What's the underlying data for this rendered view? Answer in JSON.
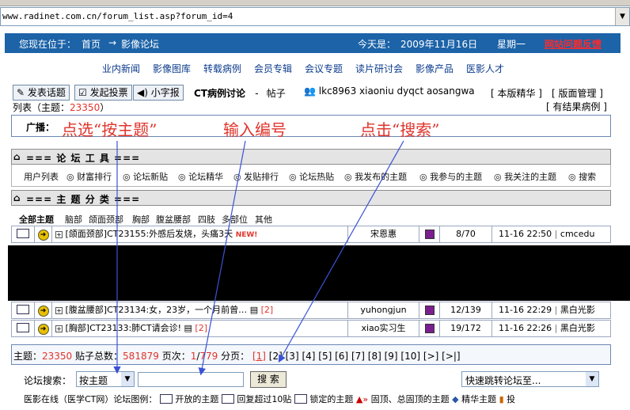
{
  "browser": {
    "url": "www.radinet.com.cn/forum_list.asp?forum_id=4"
  },
  "topbar": {
    "location_label": "您现在位于：",
    "home": "首页",
    "arrow": "→",
    "forum": "影像论坛",
    "today_label": "今天是：",
    "date": "2009年11月16日",
    "weekday": "星期一",
    "feedback": "网站问题反馈"
  },
  "nav": [
    "业内新闻",
    "影像图库",
    "转载病例",
    "会员专辑",
    "会议专题",
    "读片研讨会",
    "影像产品",
    "医影人才"
  ],
  "toolbar": {
    "post_topic": "发表话题",
    "post_vote": "发起投票",
    "small_font": "小字报",
    "board_name": "CT病例讨论",
    "dash": "-",
    "sub": "帖子",
    "list_label": "列表",
    "topic_count_prefix": "（主题：",
    "topic_count": "23350",
    "topic_count_suffix": "）",
    "moderators": "lkc8963 xiaoniu dyqct aosangwa",
    "essence": "[ 本版精华 ]",
    "manage": "[ 版面管理 ]",
    "results": "[ 有结果病例 ]"
  },
  "broadcast": {
    "label": "广播："
  },
  "annotations": {
    "step1": "点选“按主题”",
    "step2": "输入编号",
    "step3": "点击“搜索”"
  },
  "tools": {
    "header": "=== 论 坛 工 具 ===",
    "items": [
      "用户列表",
      "财富排行",
      "论坛新贴",
      "论坛精华",
      "发贴排行",
      "论坛热贴",
      "我发布的主题",
      "我参与的主题",
      "我关注的主题",
      "搜索"
    ]
  },
  "categories": {
    "header": "=== 主 题 分 类 ===",
    "all": "全部主题",
    "items": [
      "脑部",
      "颌面颈部",
      "胸部",
      "腹盆腰部",
      "四肢",
      "多部位",
      "其他"
    ]
  },
  "threads": [
    {
      "title": "[颌面颈部]CT23155:外感后发烧，头痛3天",
      "tag": "NEW!",
      "pages": "",
      "author": "宋恩惠",
      "stats": "8/70",
      "time": "11-16 22:50",
      "last": "cmcedu"
    },
    {
      "title": "[腹盆腰部]CT23134:女，23岁，一个月前曾…",
      "tag": "",
      "pages": "[2]",
      "author": "yuhongjun",
      "stats": "12/139",
      "time": "11-16 22:29",
      "last": "黑白光影"
    },
    {
      "title": "[胸部]CT23133:肺CT请会诊!",
      "tag": "",
      "pages": "[2]",
      "author": "xiao实习生",
      "stats": "19/172",
      "time": "11-16 22:26",
      "last": "黑白光影"
    }
  ],
  "summary": {
    "topics_label": "主题：",
    "topics": "23350",
    "posts_label": "贴子总数：",
    "posts": "581879",
    "page_label": "页次：",
    "page_current": "1",
    "page_sep": "/",
    "page_total": "779",
    "pager_label": "分页：",
    "pages": [
      "[1]",
      "[2]",
      "[3]",
      "[4]",
      "[5]",
      "[6]",
      "[7]",
      "[8]",
      "[9]",
      "[10]",
      "[>]",
      "[>|]"
    ]
  },
  "search": {
    "label": "论坛搜索：",
    "mode": "按主题",
    "button": "搜 索",
    "jump": "快速跳转论坛至..."
  },
  "legend": {
    "prefix": "医影在线（医学CT网）论坛图例：",
    "open": "开放的主题",
    "hot": "回复超过10贴",
    "locked": "锁定的主题",
    "pinned": "固顶、总固顶的主题",
    "essence": "精华主题",
    "vote": "投"
  },
  "colors": {
    "blue_bar": "#1c63a8",
    "annotation": "#e0352c",
    "arrow": "#3a52d6"
  }
}
